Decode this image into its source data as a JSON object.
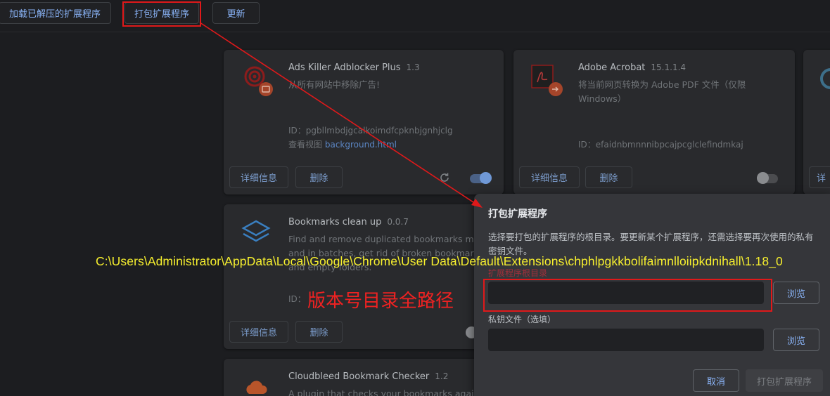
{
  "toolbar": {
    "load_unpacked": "加载已解压的扩展程序",
    "pack_extension": "打包扩展程序",
    "update": "更新"
  },
  "cards": [
    {
      "name": "Ads Killer Adblocker Plus",
      "version": "1.3",
      "description": "从所有网站中移除广告!",
      "id_label": "ID：",
      "id": "pgbllmbdjgcalkoimdfcpknbjgnhjclg",
      "inspect_label": "查看视图",
      "inspect_link": "background.html",
      "details": "详细信息",
      "remove": "删除",
      "enabled": true,
      "icon": "target-icon"
    },
    {
      "name": "Adobe Acrobat",
      "version": "15.1.1.4",
      "description": "将当前网页转换为 Adobe PDF 文件（仅限 Windows）",
      "id_label": "ID：",
      "id": "efaidnbmnnnibpcajpcglclefindmkaj",
      "details": "详细信息",
      "remove": "删除",
      "enabled": false,
      "icon": "acrobat-icon"
    },
    {
      "name": "Bookmarks clean up",
      "version": "0.0.7",
      "description": "Find and remove duplicated bookmarks manu and in batches, get rid of broken bookmark lin and empty folders.",
      "id_label": "ID：",
      "details": "详细信息",
      "remove": "删除",
      "icon": "layers-icon"
    },
    {
      "name": "Cloudbleed Bookmark Checker",
      "version": "1.2",
      "description": "A plugin that checks your bookmarks against",
      "icon": "cloud-icon"
    },
    {
      "details": "详"
    }
  ],
  "dialog": {
    "title": "打包扩展程序",
    "description": "选择要打包的扩展程序的根目录。要更新某个扩展程序，还需选择要再次使用的私有密钥文件。",
    "root_label": "扩展程序根目录",
    "root_value": "",
    "key_label": "私钥文件（选填）",
    "key_value": "",
    "browse": "浏览",
    "cancel": "取消",
    "pack": "打包扩展程序"
  },
  "annotations": {
    "path": "C:\\Users\\Administrator\\AppData\\Local\\Google\\Chrome\\User Data\\Default\\Extensions\\chphlpgkkbolifaimnlloiipkdnihall\\1.18_0",
    "note": "版本号目录全路径"
  },
  "colors": {
    "accent": "#8ab4f8",
    "annotation_red": "#e0191a",
    "annotation_yellow": "#f7f02e"
  }
}
